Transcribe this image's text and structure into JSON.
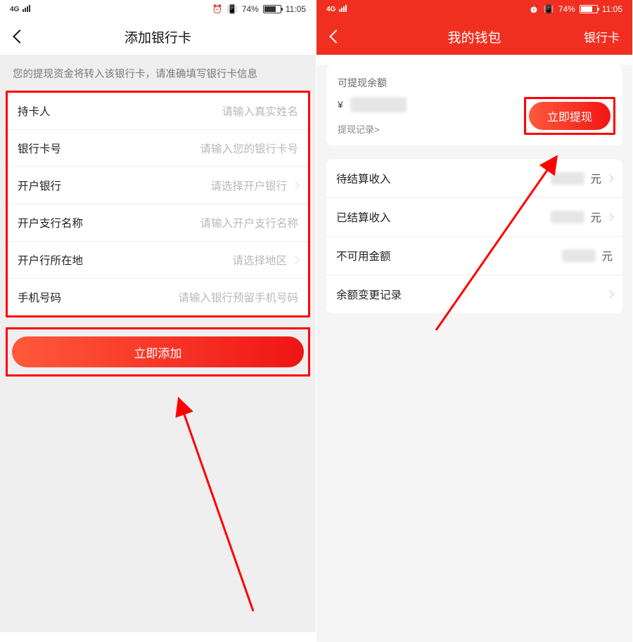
{
  "status": {
    "network": "4G",
    "battery": "74%",
    "time": "11:05"
  },
  "left": {
    "title": "添加银行卡",
    "notice": "您的提现资金将转入该银行卡，请准确填写银行卡信息",
    "fields": [
      {
        "label": "持卡人",
        "placeholder": "请输入真实姓名",
        "chevron": false
      },
      {
        "label": "银行卡号",
        "placeholder": "请输入您的银行卡号",
        "chevron": false
      },
      {
        "label": "开户银行",
        "placeholder": "请选择开户银行",
        "chevron": true
      },
      {
        "label": "开户支行名称",
        "placeholder": "请输入开户支行名称",
        "chevron": false
      },
      {
        "label": "开户行所在地",
        "placeholder": "请选择地区",
        "chevron": true
      },
      {
        "label": "手机号码",
        "placeholder": "请输入银行预留手机号码",
        "chevron": false
      }
    ],
    "add_button": "立即添加"
  },
  "right": {
    "title": "我的钱包",
    "right_link": "银行卡",
    "card": {
      "label": "可提现余额",
      "currency": "¥",
      "withdraw_button": "立即提现",
      "records_link": "提现记录>"
    },
    "rows": [
      {
        "label": "待结算收入",
        "unit": "元",
        "blurred": true,
        "chevron": true
      },
      {
        "label": "已结算收入",
        "unit": "元",
        "blurred": true,
        "chevron": true
      },
      {
        "label": "不可用金额",
        "unit": "元",
        "blurred": true,
        "chevron": false
      },
      {
        "label": "余额变更记录",
        "unit": "",
        "blurred": false,
        "chevron": true
      }
    ]
  }
}
